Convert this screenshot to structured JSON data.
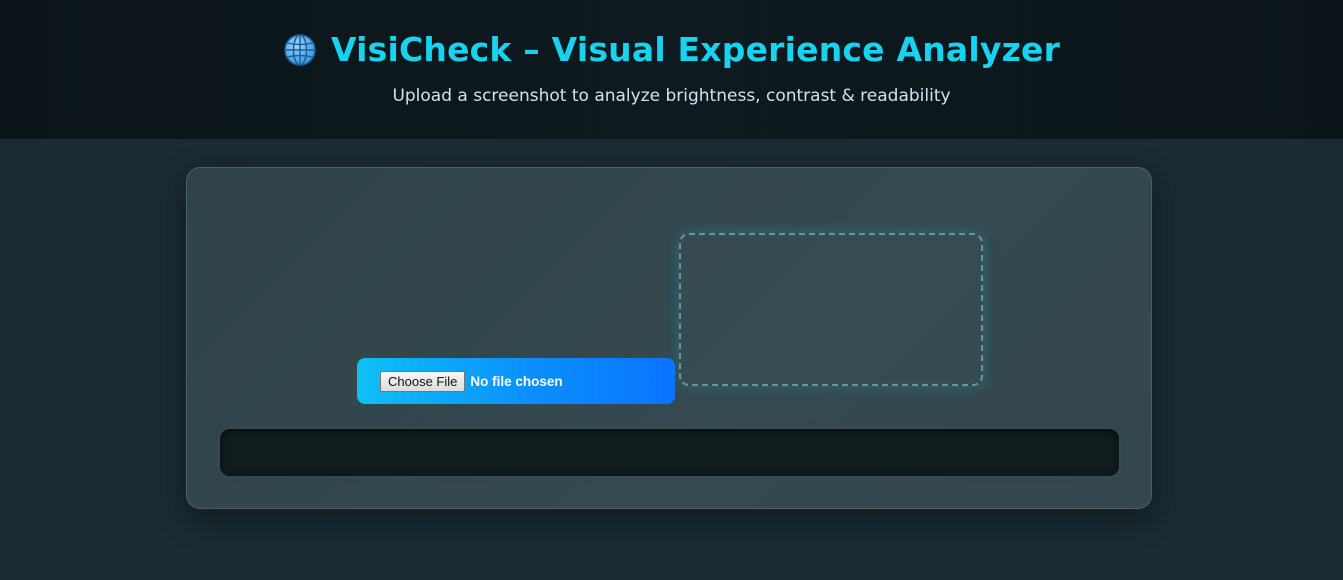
{
  "header": {
    "icon": "globe-icon",
    "title": "VisiCheck – Visual Experience Analyzer",
    "subtitle": "Upload a screenshot to analyze brightness, contrast & readability"
  },
  "upload": {
    "button_label": "Choose File",
    "status_text": "No file chosen"
  },
  "colors": {
    "title": "#17d3ef",
    "subtitle": "#cfe3ec",
    "background": "#1a2b32",
    "header_background": "#0b1519",
    "card_background": "#33474d",
    "picker_gradient_start": "#0ec0f5",
    "picker_gradient_end": "#0a74ff",
    "result_bar": "#111c1f"
  }
}
